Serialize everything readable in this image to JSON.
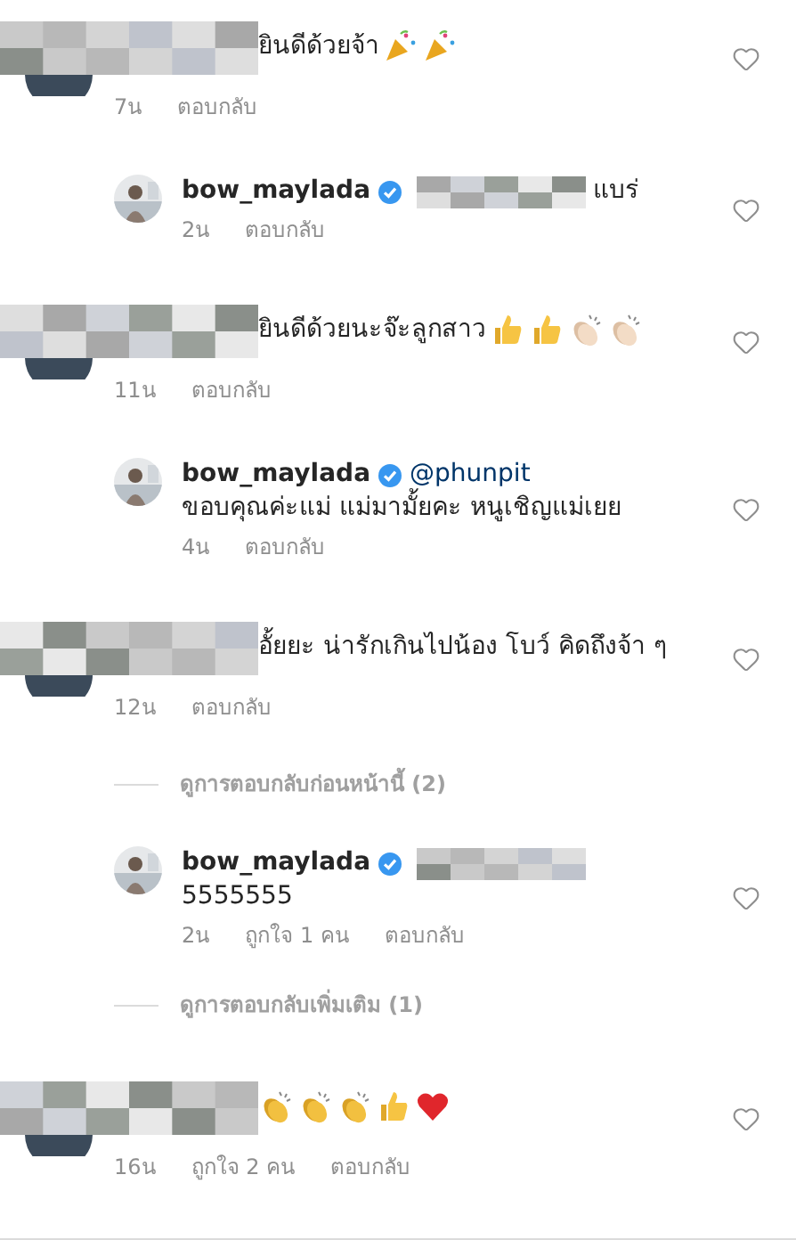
{
  "comments": [
    {
      "kind": "comment",
      "text": "ยินดีด้วยจ้า",
      "emojis": [
        {
          "kind": "party"
        },
        {
          "kind": "party"
        }
      ],
      "time": "7น",
      "reply": "ตอบกลับ"
    },
    {
      "kind": "reply",
      "username": "bow_maylada",
      "verified": true,
      "redacted": true,
      "text": "แบร่",
      "time": "2น",
      "reply": "ตอบกลับ"
    },
    {
      "kind": "comment",
      "text": "ยินดีด้วยนะจ๊ะลูกสาว",
      "emojis": [
        {
          "kind": "thumbs"
        },
        {
          "kind": "thumbs"
        },
        {
          "kind": "clap-pale"
        },
        {
          "kind": "clap-pale"
        }
      ],
      "time": "11น",
      "reply": "ตอบกลับ"
    },
    {
      "kind": "reply",
      "username": "bow_maylada",
      "verified": true,
      "mention": "@phunpit",
      "text": "ขอบคุณค่ะแม่ แม่มามั้ยคะ หนูเชิญแม่เยย",
      "time": "4น",
      "reply": "ตอบกลับ"
    },
    {
      "kind": "comment",
      "text": "อั้ยยะ น่ารักเกินไปน้อง โบว์ คิดถึงจ้า ๆ",
      "time": "12น",
      "reply": "ตอบกลับ"
    },
    {
      "kind": "view-replies",
      "text": "ดูการตอบกลับก่อนหน้านี้ (2)"
    },
    {
      "kind": "reply",
      "username": "bow_maylada",
      "verified": true,
      "redacted": true,
      "text": "5555555",
      "break": true,
      "time": "2น",
      "likes": "ถูกใจ 1 คน",
      "reply": "ตอบกลับ"
    },
    {
      "kind": "view-replies",
      "text": "ดูการตอบกลับเพิ่มเติม (1)"
    },
    {
      "kind": "comment",
      "emojis": [
        {
          "kind": "clap"
        },
        {
          "kind": "clap"
        },
        {
          "kind": "clap"
        },
        {
          "kind": "thumbs"
        },
        {
          "kind": "heart"
        }
      ],
      "time": "16น",
      "likes": "ถูกใจ 2 คน",
      "reply": "ตอบกลับ"
    }
  ]
}
